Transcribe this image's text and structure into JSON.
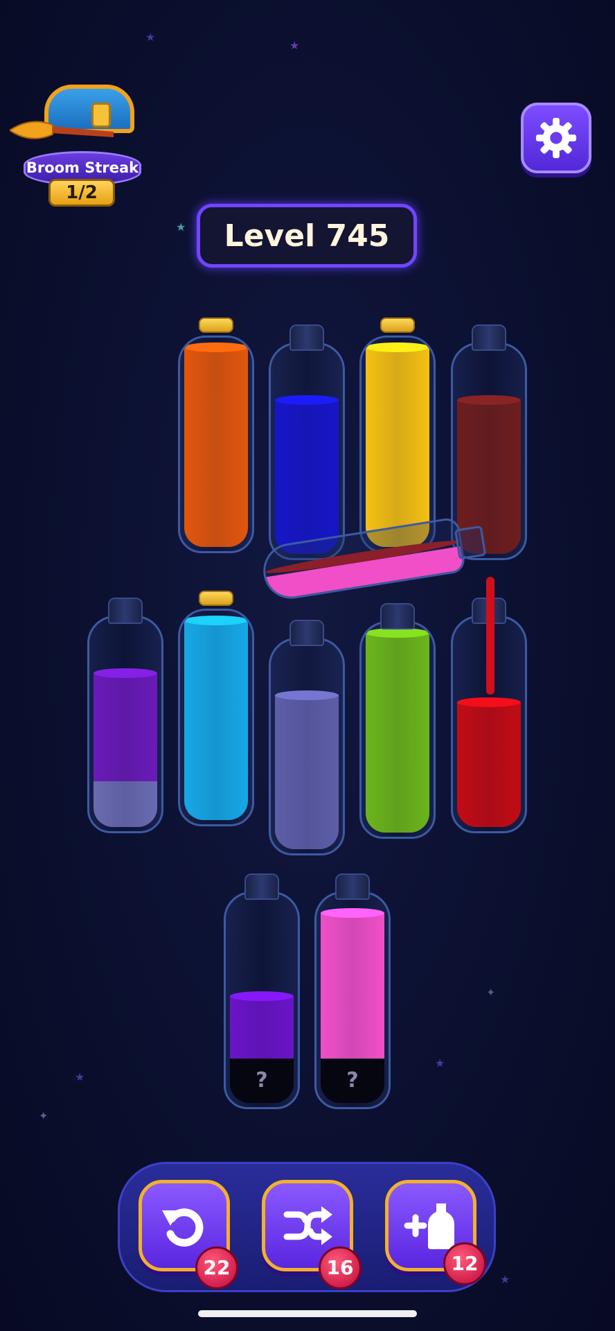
{
  "streak": {
    "label": "Broom Streak",
    "count": "1/2"
  },
  "level": {
    "label": "Level 745"
  },
  "bottles": [
    {
      "id": "b1",
      "cork": true,
      "layers": [
        {
          "color": "#e2560b",
          "fraction": 0.96
        }
      ]
    },
    {
      "id": "b2",
      "cork": false,
      "layers": [
        {
          "color": "#1616c8",
          "fraction": 0.74
        }
      ]
    },
    {
      "id": "b3",
      "cork": true,
      "layers": [
        {
          "color": "#f5c012",
          "fraction": 0.96
        }
      ]
    },
    {
      "id": "b4",
      "cork": false,
      "layers": [
        {
          "color": "#6e1d1d",
          "fraction": 0.74
        }
      ]
    },
    {
      "id": "b5",
      "cork": false,
      "layers": [
        {
          "color": "#6a6ab0",
          "fraction": 0.22
        },
        {
          "color": "#6a1ab8",
          "fraction": 0.74
        }
      ]
    },
    {
      "id": "b6",
      "cork": true,
      "layers": [
        {
          "color": "#16a8e6",
          "fraction": 0.96
        }
      ]
    },
    {
      "id": "b7",
      "cork": false,
      "layers": [
        {
          "color": "#5e5ea8",
          "fraction": 0.74
        }
      ]
    },
    {
      "id": "b8",
      "cork": false,
      "layers": [
        {
          "color": "#6cb51a",
          "fraction": 0.96
        }
      ]
    },
    {
      "id": "b9",
      "cork": false,
      "layers": [
        {
          "color": "#c20b14",
          "fraction": 0.6
        }
      ]
    },
    {
      "id": "b10",
      "cork": false,
      "hidden_label": "?",
      "layers": [
        {
          "color": "#6a14c8",
          "fraction": 0.3
        }
      ]
    },
    {
      "id": "b11",
      "cork": false,
      "hidden_label": "?",
      "layers": [
        {
          "color": "#f04fc8",
          "fraction": 0.7
        }
      ]
    }
  ],
  "pouring_bottle": {
    "colors": [
      "#f04fc8",
      "#8b1f2a"
    ]
  },
  "actions": [
    {
      "name": "undo",
      "count": "22"
    },
    {
      "name": "shuffle",
      "count": "16"
    },
    {
      "name": "add-bottle",
      "count": "12"
    }
  ]
}
